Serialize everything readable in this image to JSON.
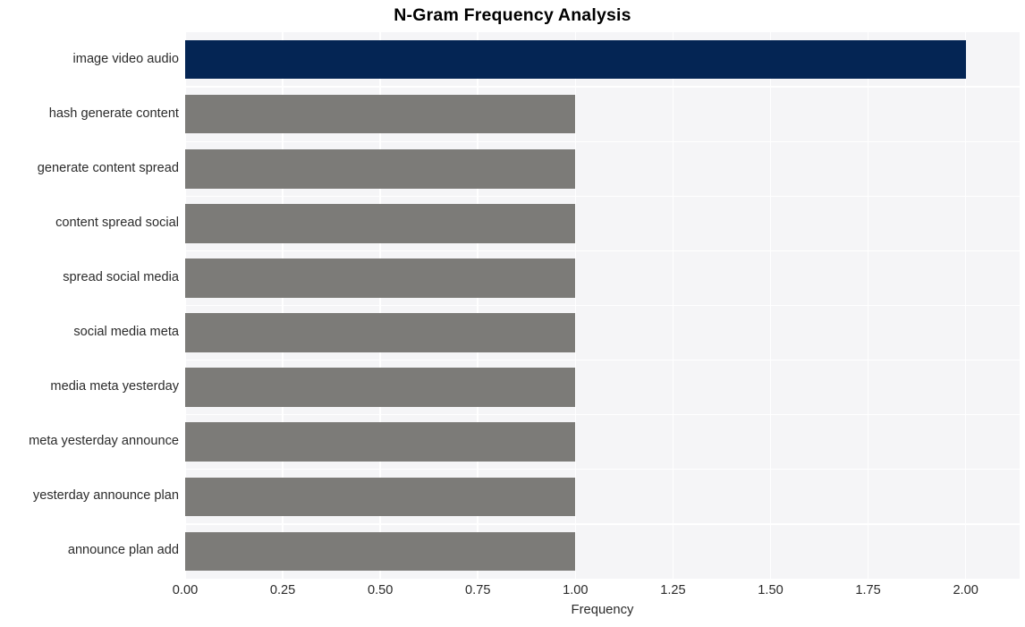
{
  "chart_data": {
    "type": "bar",
    "orientation": "horizontal",
    "title": "N-Gram Frequency Analysis",
    "xlabel": "Frequency",
    "ylabel": "",
    "categories": [
      "image video audio",
      "hash generate content",
      "generate content spread",
      "content spread social",
      "spread social media",
      "social media meta",
      "media meta yesterday",
      "meta yesterday announce",
      "yesterday announce plan",
      "announce plan add"
    ],
    "values": [
      2,
      1,
      1,
      1,
      1,
      1,
      1,
      1,
      1,
      1
    ],
    "bar_colors": [
      "#042554",
      "#7c7b78",
      "#7c7b78",
      "#7c7b78",
      "#7c7b78",
      "#7c7b78",
      "#7c7b78",
      "#7c7b78",
      "#7c7b78",
      "#7c7b78"
    ],
    "xlim": [
      0,
      2.1383
    ],
    "xticks": [
      0,
      0.25,
      0.5,
      0.75,
      1,
      1.25,
      1.5,
      1.75,
      2
    ],
    "xtick_labels": [
      "0.00",
      "0.25",
      "0.50",
      "0.75",
      "1.00",
      "1.25",
      "1.50",
      "1.75",
      "2.00"
    ],
    "grid": true,
    "grid_color": "#ffffff",
    "plot_background": "#f5f5f7",
    "figure_background": "#ffffff",
    "legend": null,
    "highlight_color": "#042554",
    "default_color": "#7c7b78"
  }
}
